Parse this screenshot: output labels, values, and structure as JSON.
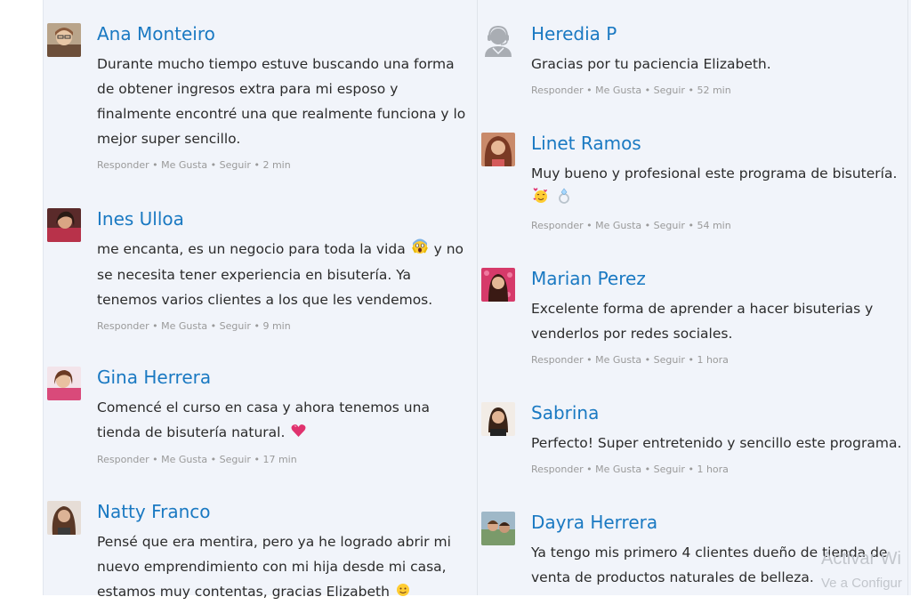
{
  "comments_left": [
    {
      "name": "Ana Monteiro",
      "text": "Durante mucho tiempo estuve buscando una forma de obtener ingresos extra para mi esposo y finalmente encontré una que realmente funciona y lo mejor super sencillo.",
      "actions": [
        "Responder",
        "Me Gusta",
        "Seguir"
      ],
      "time": "2 min"
    },
    {
      "name": "Ines Ulloa",
      "text_before_emoji": "me encanta, es un negocio para toda la vida",
      "emoji": "screaming-face-emoji",
      "text_after_emoji": "y no se necesita tener experiencia en bisutería. Ya tenemos varios clientes a los que les vendemos.",
      "actions": [
        "Responder",
        "Me Gusta",
        "Seguir"
      ],
      "time": "9 min"
    },
    {
      "name": "Gina Herrera",
      "text": "Comencé el curso en casa y ahora tenemos una tienda de bisutería natural.",
      "emoji": "pink-heart-emoji",
      "actions": [
        "Responder",
        "Me Gusta",
        "Seguir"
      ],
      "time": "17 min"
    },
    {
      "name": "Natty Franco",
      "text": "Pensé que era mentira, pero ya he logrado abrir mi nuevo emprendimiento con mi hija desde mi casa, estamos muy contentas, gracias Elizabeth"
    }
  ],
  "comments_right": [
    {
      "name": "Heredia P",
      "text": "Gracias por tu paciencia Elizabeth.",
      "actions": [
        "Responder",
        "Me Gusta",
        "Seguir"
      ],
      "time": "52 min",
      "avatar": "support-agent-icon"
    },
    {
      "name": "Linet Ramos",
      "text": "Muy bueno y profesional este programa de bisutería.",
      "emojis": [
        "smiling-face-with-hearts-emoji",
        "ring-emoji"
      ],
      "actions": [
        "Responder",
        "Me Gusta",
        "Seguir"
      ],
      "time": "54 min"
    },
    {
      "name": "Marian Perez",
      "text": "Excelente forma de aprender a hacer bisuterias y venderlos por redes sociales.",
      "actions": [
        "Responder",
        "Me Gusta",
        "Seguir"
      ],
      "time": "1 hora"
    },
    {
      "name": "Sabrina",
      "text": "Perfecto! Super entretenido y sencillo este programa.",
      "actions": [
        "Responder",
        "Me Gusta",
        "Seguir"
      ],
      "time": "1 hora"
    },
    {
      "name": "Dayra Herrera",
      "text": "Ya tengo mis primero 4 clientes dueño de tienda de venta de productos naturales de belleza."
    }
  ],
  "meta_separator": "•",
  "watermark": {
    "line1": "Activar Wi",
    "line2": "Ve a Configur"
  },
  "colors": {
    "name": "#1a79c2",
    "text": "#2b2b2b",
    "meta": "#9a9a9a",
    "panel_bg": "#f1f4fa"
  }
}
